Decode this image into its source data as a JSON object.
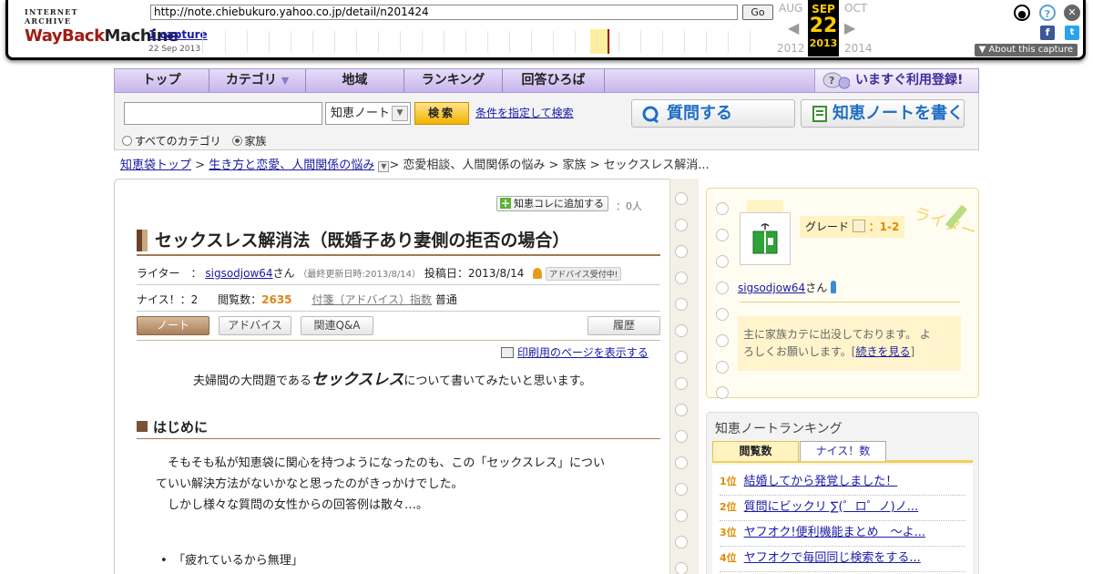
{
  "wayback": {
    "logo_line1": "INTERNET ARCHIVE",
    "logo_way": "WayBack",
    "logo_machine": "Machine",
    "url": "http://note.chiebukuro.yahoo.co.jp/detail/n201424",
    "go_label": "Go",
    "captures_label": "1 capture",
    "captures_date": "22 Sep 2013",
    "prev_month": "AUG",
    "prev_year": "2012",
    "sel_month": "SEP",
    "sel_day": "22",
    "sel_year": "2013",
    "next_month": "OCT",
    "next_year": "2014",
    "about_label": "▼ About this capture"
  },
  "nav": {
    "items": [
      "トップ",
      "カテゴリ",
      "地域",
      "ランキング",
      "回答ひろば"
    ],
    "category_arrow": "▼",
    "register_label": "いますぐ利用登録!"
  },
  "search": {
    "input_value": "",
    "select_value": "知恵ノート",
    "button_label": "検索",
    "advanced_link": "条件を指定して検索",
    "radio_all": "すべてのカテゴリ",
    "radio_family": "家族",
    "ask_button": "質問する",
    "write_button": "知恵ノートを書く"
  },
  "breadcrumb": {
    "top": "知恵袋トップ",
    "sep": " > ",
    "cat1": "生き方と恋愛、人間関係の悩み",
    "rest": "> 恋愛相談、人間関係の悩み > 家族 > セックスレス解消..."
  },
  "note": {
    "add_fav_label": "知恵コレに追加する",
    "fav_count": "：0人",
    "title": "セックスレス解消法（既婚子あり妻側の拒否の場合）",
    "writer_label": "ライター　：",
    "writer_name": "sigsodjow64",
    "writer_suffix": "さん",
    "updated": "（最終更新日時:2013/8/14）",
    "posted": "投稿日：2013/8/14",
    "advice_badge": "アドバイス受付中!",
    "nice": "ナイス！：2",
    "views_label": "閲覧数：",
    "views_value": "2635",
    "index_label": "付箋（アドバイス）指数",
    "index_value": "普通",
    "tabs": [
      "ノート",
      "アドバイス",
      "関連Q&A",
      "履歴"
    ],
    "print_link": "印刷用のページを表示する",
    "intro_pre": "夫婦間の大問題である",
    "intro_em": "セックスレス",
    "intro_post": "について書いてみたいと思います。",
    "section1": "はじめに",
    "para1a": "　そもそも私が知恵袋に関心を持つようになったのも、この「セックスレス」につい",
    "para1b": "ていい解決方法がないかなと思ったのがきっかけでした。",
    "para2": "　しかし様々な質問の女性からの回答例は散々…。",
    "bullet1": "「疲れているから無理」"
  },
  "profile": {
    "grade_label": "グレード",
    "grade_value": "：1-2",
    "deco_text": "ライター",
    "name": "sigsodjow64",
    "name_suffix": "さん",
    "msg_line1": "主に家族カテに出没しております。 よ",
    "msg_line2": "ろしくお願いします。[",
    "msg_more": "続きを見る",
    "msg_end": "]"
  },
  "ranking": {
    "title": "知恵ノートランキング",
    "tab_views": "閲覧数",
    "tab_nice": "ナイス！数",
    "items": [
      {
        "pos": "1位",
        "text": "結婚してから発覚しました！"
      },
      {
        "pos": "2位",
        "text": "質問にビックリ ∑(゜ロ゜ノ)ノ..."
      },
      {
        "pos": "3位",
        "text": "ヤフオク!便利機能まとめ　～よ..."
      },
      {
        "pos": "4位",
        "text": "ヤフオクで毎回同じ検索をする..."
      }
    ]
  },
  "colors": {
    "nav_bg": "#d9cdf3",
    "accent_brown": "#7b5233",
    "link": "#1a1aa6",
    "rank_orange": "#e08a00"
  }
}
